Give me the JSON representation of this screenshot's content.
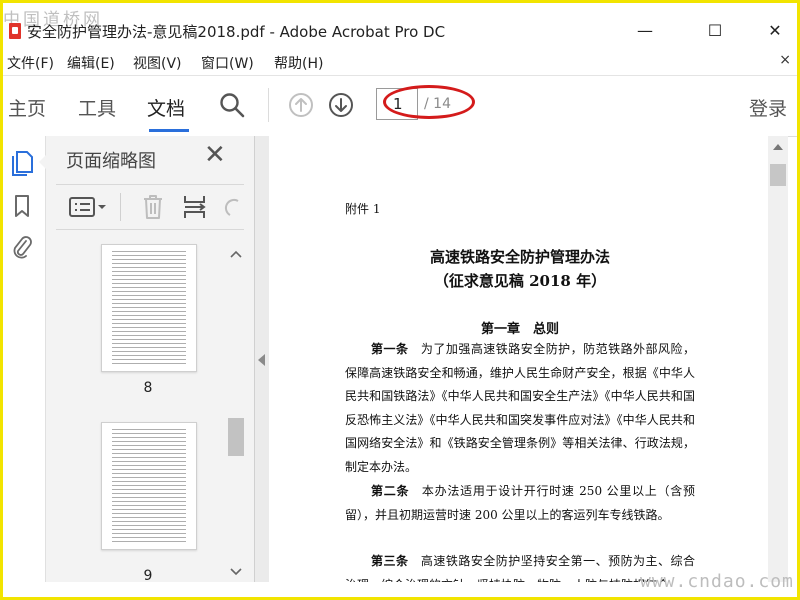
{
  "watermark_top": "中国道桥网",
  "watermark_bottom": "www.cndao.com",
  "window": {
    "title": "安全防护管理办法-意见稿2018.pdf - Adobe Acrobat Pro DC",
    "controls": {
      "minimize": "—",
      "maximize": "☐",
      "close": "✕"
    }
  },
  "menu": {
    "items": [
      "文件(F)",
      "编辑(E)",
      "视图(V)",
      "窗口(W)",
      "帮助(H)"
    ],
    "close_doc": "×"
  },
  "toolbar": {
    "tabs": [
      "主页",
      "工具",
      "文档"
    ],
    "active_tab": "文档",
    "page_current": "1",
    "page_total": "/ 14",
    "signin": "登录"
  },
  "panel": {
    "title": "页面缩略图",
    "close": "✕",
    "thumbnails": [
      {
        "label": "8"
      },
      {
        "label": "9"
      }
    ]
  },
  "document": {
    "attachment": "附件 1",
    "title": "高速铁路安全防护管理办法",
    "subtitle": "（征求意见稿 2018 年）",
    "chapter": "第一章　总则",
    "paragraphs": [
      {
        "article": "第一条",
        "text": "　为了加强高速铁路安全防护，防范铁路外部风险，保障高速铁路安全和畅通，维护人民生命财产安全，根据《中华人民共和国铁路法》《中华人民共和国安全生产法》《中华人民共和国反恐怖主义法》《中华人民共和国突发事件应对法》《中华人民共和国网络安全法》和《铁路安全管理条例》等相关法律、行政法规，制定本办法。"
      },
      {
        "article": "第二条",
        "text": "　本办法适用于设计开行时速 250 公里以上（含预留），并且初期运营时速 200 公里以上的客运列车专线铁路。"
      },
      {
        "article": "第三条",
        "text": "　高速铁路安全防护坚持安全第一、预防为主、综合治理，综合治理的方针，坚持协防、物防、人防与技防相结合…"
      }
    ]
  },
  "colors": {
    "frame_border": "#f2e400",
    "accent_underline": "#2a6fdb",
    "rail_active": "#2a6fdb",
    "annotation_ellipse": "#d41b1b"
  }
}
